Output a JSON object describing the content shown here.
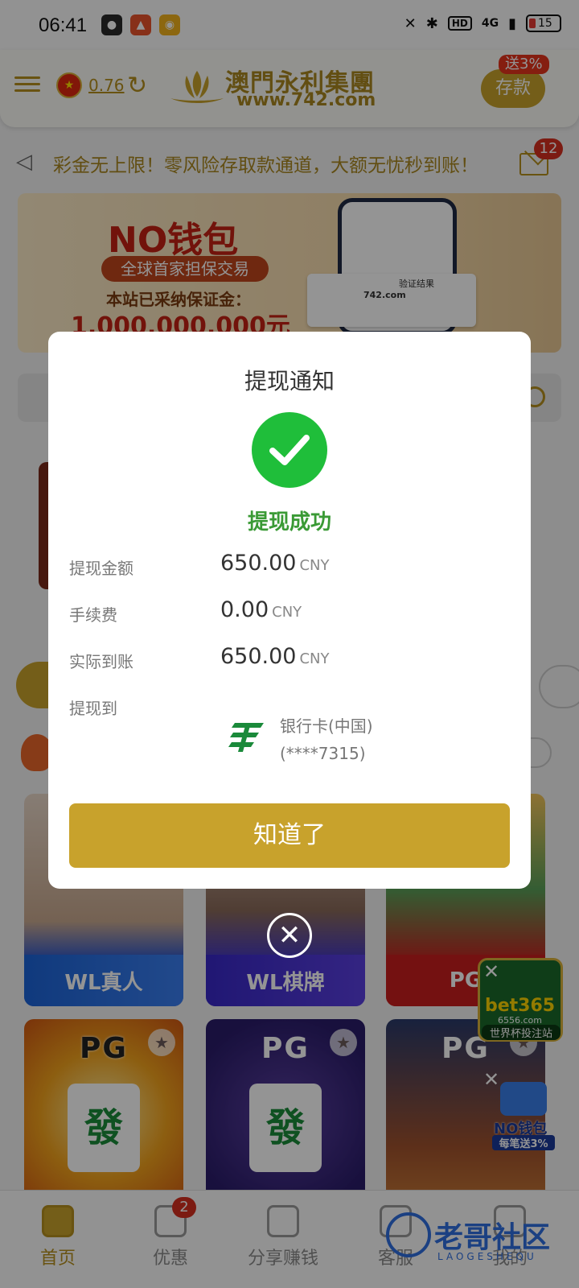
{
  "status_bar": {
    "time": "06:41",
    "network": "4G",
    "battery": "15"
  },
  "header": {
    "balance": "0.76",
    "brand_name": "澳門永利集團",
    "brand_url": "www.742.com",
    "deposit_label": "存款",
    "deposit_bonus": "送3%"
  },
  "marquee": {
    "text": "彩金无上限！零风险存取款通道，大额无忧秒到账！",
    "mail_count": "12"
  },
  "banner": {
    "headline": "NO钱包",
    "tagline": "全球首家担保交易",
    "subline": "本站已采纳保证金：",
    "amount": "1,000,000,000元",
    "card_title": "验证结果",
    "card_url": "742.com"
  },
  "games": [
    {
      "label": "WL真人",
      "brand": "WL"
    },
    {
      "label": "WL棋牌",
      "brand": "WL"
    },
    {
      "label": "PG",
      "brand": "PG"
    }
  ],
  "game_tiles_row2": [
    {
      "brand": "PG",
      "glyph": "發"
    },
    {
      "brand": "PG",
      "glyph": "發"
    },
    {
      "brand": "PG"
    }
  ],
  "float_ads": {
    "bet365_name": "bet365",
    "bet365_url": "6556.com",
    "bet365_tagline": "世界杯投注站",
    "nowallet_name": "NO钱包",
    "nowallet_tagline": "每笔送3%"
  },
  "bottom_nav": [
    {
      "label": "首页",
      "active": true
    },
    {
      "label": "优惠",
      "badge": "2"
    },
    {
      "label": "分享赚钱"
    },
    {
      "label": "客服"
    },
    {
      "label": "我的"
    }
  ],
  "watermark": {
    "text": "老哥社区",
    "sub": "LAOGESHEQU"
  },
  "modal": {
    "title": "提现通知",
    "status": "提现成功",
    "rows": [
      {
        "label": "提现金额",
        "value": "650.00",
        "unit": "CNY"
      },
      {
        "label": "手续费",
        "value": "0.00",
        "unit": "CNY"
      },
      {
        "label": "实际到账",
        "value": "650.00",
        "unit": "CNY"
      }
    ],
    "destination_label": "提现到",
    "bank_name": "银行卡(中国)",
    "bank_account": "(****7315)",
    "confirm_label": "知道了"
  },
  "colors": {
    "gold": "#c8a22c",
    "success_green": "#1fbe3a",
    "badge_red": "#d63020"
  }
}
